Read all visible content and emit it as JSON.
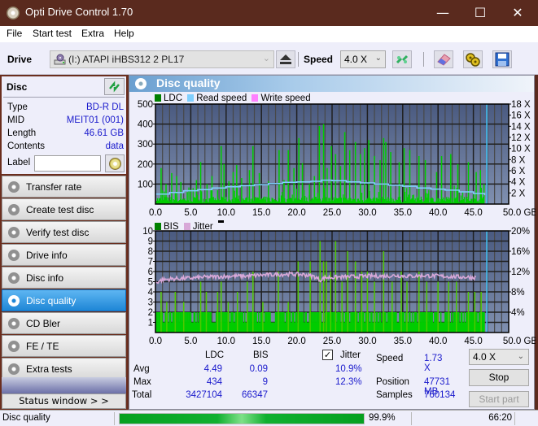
{
  "window": {
    "title": "Opti Drive Control 1.70",
    "minimize": "—",
    "maximize": "☐",
    "close": "✕"
  },
  "menu": [
    "File",
    "Start test",
    "Extra",
    "Help"
  ],
  "toolbar": {
    "drive_label": "Drive",
    "drive_value": "(I:)  ATAPI iHBS312  2 PL17",
    "speed_label": "Speed",
    "speed_value": "4.0 X",
    "icons": [
      "eject-icon",
      "swap-icon",
      "eraser-icon",
      "settings-icon",
      "save-icon"
    ]
  },
  "disc": {
    "header": "Disc",
    "fields": [
      {
        "key": "Type",
        "value": "BD-R DL"
      },
      {
        "key": "MID",
        "value": "MEIT01 (001)"
      },
      {
        "key": "Length",
        "value": "46.61 GB"
      },
      {
        "key": "Contents",
        "value": "data"
      }
    ],
    "label_key": "Label",
    "label_value": ""
  },
  "nav": [
    {
      "label": "Transfer rate",
      "active": false
    },
    {
      "label": "Create test disc",
      "active": false
    },
    {
      "label": "Verify test disc",
      "active": false
    },
    {
      "label": "Drive info",
      "active": false
    },
    {
      "label": "Disc info",
      "active": false
    },
    {
      "label": "Disc quality",
      "active": true
    },
    {
      "label": "CD Bler",
      "active": false
    },
    {
      "label": "FE / TE",
      "active": false
    },
    {
      "label": "Extra tests",
      "active": false
    }
  ],
  "status_window_label": "Status window > >",
  "panel_title": "Disc quality",
  "colors": {
    "ldc": "#008000",
    "bis": "#008000",
    "read_speed": "#80d0ff",
    "write_speed": "#ff80ff",
    "jitter": "#d8a8d8",
    "bars": "#00cc00",
    "plot_top": "#4a5a80",
    "plot_bottom": "#8090b0",
    "marker": "#40c8ff"
  },
  "chart_data": [
    {
      "type": "bar",
      "title": "LDC / Read speed",
      "legend": [
        "LDC",
        "Read speed",
        "Write speed"
      ],
      "legend_position": "top-left",
      "xlabel": "GB",
      "xlim": [
        0,
        50
      ],
      "x_ticks": [
        "0.0",
        "5.0",
        "10.0",
        "15.0",
        "20.0",
        "25.0",
        "30.0",
        "35.0",
        "40.0",
        "45.0",
        "50.0 GB"
      ],
      "ylim_left": [
        0,
        500
      ],
      "y_ticks_left": [
        "100",
        "200",
        "300",
        "400",
        "500"
      ],
      "ylim_right": [
        0,
        18
      ],
      "y_ticks_right": [
        "2 X",
        "4 X",
        "6 X",
        "8 X",
        "10 X",
        "12 X",
        "14 X",
        "16 X",
        "18 X"
      ],
      "grid": true,
      "end_marker_gb": 46.9,
      "ldc_peaks": [
        {
          "x": 0.8,
          "y": 180
        },
        {
          "x": 1.5,
          "y": 100
        },
        {
          "x": 2.3,
          "y": 155
        },
        {
          "x": 3.0,
          "y": 140
        },
        {
          "x": 3.6,
          "y": 110
        },
        {
          "x": 4.5,
          "y": 60
        },
        {
          "x": 5.8,
          "y": 120
        },
        {
          "x": 6.4,
          "y": 210
        },
        {
          "x": 7.3,
          "y": 100
        },
        {
          "x": 8.0,
          "y": 140
        },
        {
          "x": 8.8,
          "y": 70
        },
        {
          "x": 9.3,
          "y": 290
        },
        {
          "x": 9.7,
          "y": 200
        },
        {
          "x": 10.4,
          "y": 115
        },
        {
          "x": 11.0,
          "y": 160
        },
        {
          "x": 11.5,
          "y": 195
        },
        {
          "x": 12.2,
          "y": 130
        },
        {
          "x": 13.3,
          "y": 170
        },
        {
          "x": 13.8,
          "y": 290
        },
        {
          "x": 14.7,
          "y": 155
        },
        {
          "x": 16.0,
          "y": 115
        },
        {
          "x": 17.5,
          "y": 270
        },
        {
          "x": 18.2,
          "y": 120
        },
        {
          "x": 18.8,
          "y": 270
        },
        {
          "x": 19.6,
          "y": 180
        },
        {
          "x": 20.3,
          "y": 330
        },
        {
          "x": 20.8,
          "y": 205
        },
        {
          "x": 21.8,
          "y": 100
        },
        {
          "x": 22.5,
          "y": 140
        },
        {
          "x": 23.2,
          "y": 390
        },
        {
          "x": 23.8,
          "y": 400
        },
        {
          "x": 24.3,
          "y": 180
        },
        {
          "x": 24.9,
          "y": 290
        },
        {
          "x": 25.5,
          "y": 250
        },
        {
          "x": 26.2,
          "y": 190
        },
        {
          "x": 26.8,
          "y": 360
        },
        {
          "x": 27.5,
          "y": 270
        },
        {
          "x": 28.3,
          "y": 310
        },
        {
          "x": 29.0,
          "y": 250
        },
        {
          "x": 29.6,
          "y": 280
        },
        {
          "x": 30.2,
          "y": 320
        },
        {
          "x": 31.0,
          "y": 240
        },
        {
          "x": 31.8,
          "y": 220
        },
        {
          "x": 32.3,
          "y": 330
        },
        {
          "x": 32.6,
          "y": 310
        },
        {
          "x": 33.3,
          "y": 260
        },
        {
          "x": 34.5,
          "y": 210
        },
        {
          "x": 35.2,
          "y": 280
        },
        {
          "x": 36.0,
          "y": 270
        },
        {
          "x": 37.3,
          "y": 240
        },
        {
          "x": 38.2,
          "y": 220
        },
        {
          "x": 39.8,
          "y": 160
        },
        {
          "x": 40.5,
          "y": 240
        },
        {
          "x": 41.8,
          "y": 250
        },
        {
          "x": 42.8,
          "y": 200
        },
        {
          "x": 44.3,
          "y": 210
        },
        {
          "x": 45.4,
          "y": 160
        },
        {
          "x": 46.0,
          "y": 170
        },
        {
          "x": 46.5,
          "y": 100
        }
      ],
      "ldc_baseline": 25,
      "read_speed_x": [
        0,
        2,
        4,
        6,
        8,
        10,
        12,
        14,
        16,
        18,
        20,
        22,
        23.5,
        25,
        27,
        29,
        31,
        33,
        35,
        37,
        39,
        41,
        43,
        45,
        46.6
      ],
      "read_speed_y": [
        1.8,
        2.1,
        2.4,
        2.6,
        2.9,
        3.1,
        3.3,
        3.5,
        3.7,
        3.9,
        4.0,
        4.1,
        4.3,
        4.2,
        4.0,
        3.8,
        3.6,
        3.4,
        3.2,
        2.9,
        2.7,
        2.5,
        2.2,
        1.9,
        1.6
      ]
    },
    {
      "type": "bar",
      "title": "BIS / Jitter",
      "legend": [
        "BIS",
        "Jitter"
      ],
      "legend_position": "top-left",
      "xlabel": "GB",
      "xlim": [
        0,
        50
      ],
      "x_ticks": [
        "0.0",
        "5.0",
        "10.0",
        "15.0",
        "20.0",
        "25.0",
        "30.0",
        "35.0",
        "40.0",
        "45.0",
        "50.0 GB"
      ],
      "ylim_left": [
        0,
        10
      ],
      "y_ticks_left": [
        "1",
        "2",
        "3",
        "4",
        "5",
        "6",
        "7",
        "8",
        "9",
        "10"
      ],
      "ylim_right": [
        0,
        20
      ],
      "y_ticks_right": [
        "4%",
        "8%",
        "12%",
        "16%",
        "20%"
      ],
      "grid": true,
      "end_marker_gb": 46.9,
      "bis_peaks": [
        {
          "x": 0.8,
          "y": 4
        },
        {
          "x": 1.6,
          "y": 3
        },
        {
          "x": 2.8,
          "y": 4
        },
        {
          "x": 4.0,
          "y": 3
        },
        {
          "x": 6.4,
          "y": 5
        },
        {
          "x": 7.2,
          "y": 4
        },
        {
          "x": 8.8,
          "y": 4
        },
        {
          "x": 9.3,
          "y": 5
        },
        {
          "x": 10.3,
          "y": 3
        },
        {
          "x": 11.6,
          "y": 4
        },
        {
          "x": 13.0,
          "y": 5
        },
        {
          "x": 13.8,
          "y": 6
        },
        {
          "x": 15.2,
          "y": 3
        },
        {
          "x": 17.4,
          "y": 6
        },
        {
          "x": 18.8,
          "y": 3
        },
        {
          "x": 20.2,
          "y": 7
        },
        {
          "x": 21.9,
          "y": 7
        },
        {
          "x": 23.3,
          "y": 9
        },
        {
          "x": 23.8,
          "y": 7
        },
        {
          "x": 24.2,
          "y": 7
        },
        {
          "x": 24.8,
          "y": 6
        },
        {
          "x": 25.5,
          "y": 9
        },
        {
          "x": 26.4,
          "y": 5
        },
        {
          "x": 27.2,
          "y": 8
        },
        {
          "x": 28.3,
          "y": 7
        },
        {
          "x": 29.2,
          "y": 6
        },
        {
          "x": 30.0,
          "y": 6
        },
        {
          "x": 31.0,
          "y": 5
        },
        {
          "x": 32.3,
          "y": 8
        },
        {
          "x": 33.5,
          "y": 5
        },
        {
          "x": 34.8,
          "y": 6
        },
        {
          "x": 35.6,
          "y": 5
        },
        {
          "x": 37.3,
          "y": 6
        },
        {
          "x": 38.4,
          "y": 5
        },
        {
          "x": 40.0,
          "y": 5
        },
        {
          "x": 41.5,
          "y": 5
        },
        {
          "x": 42.6,
          "y": 5
        },
        {
          "x": 44.3,
          "y": 4
        },
        {
          "x": 45.2,
          "y": 4
        },
        {
          "x": 46.1,
          "y": 4
        }
      ],
      "bis_baseline": 2,
      "bis_base_fill": 1,
      "jitter_x": [
        0,
        1,
        3,
        5,
        7,
        9,
        11,
        13,
        15,
        17,
        19,
        21,
        22.5,
        23.3,
        24,
        26,
        28,
        30,
        32,
        34,
        36,
        38,
        40,
        42,
        44,
        45.4
      ],
      "jitter_y": [
        9.8,
        10.4,
        10.6,
        10.7,
        10.9,
        11.0,
        11.1,
        11.1,
        11.3,
        11.4,
        11.5,
        11.4,
        11.0,
        10.3,
        10.8,
        10.9,
        11.0,
        11.1,
        11.1,
        11.2,
        11.1,
        11.2,
        11.1,
        11.0,
        10.9,
        10.8
      ]
    }
  ],
  "stats": {
    "headers": [
      "LDC",
      "BIS"
    ],
    "rows": [
      {
        "label": "Avg",
        "ldc": "4.49",
        "bis": "0.09",
        "jitter": "10.9%"
      },
      {
        "label": "Max",
        "ldc": "434",
        "bis": "9",
        "jitter": "12.3%"
      },
      {
        "label": "Total",
        "ldc": "3427104",
        "bis": "66347"
      }
    ],
    "jitter_label": "Jitter",
    "jitter_checked": true,
    "speed_label": "Speed",
    "speed_value": "1.73 X",
    "position_label": "Position",
    "position_value": "47731 MB",
    "samples_label": "Samples",
    "samples_value": "760134",
    "speed_select": "4.0 X",
    "stop_label": "Stop",
    "start_part_label": "Start part"
  },
  "statusbar": {
    "text": "Disc quality",
    "progress": 0.999,
    "progress_text": "99.9%",
    "time": "66:20"
  }
}
